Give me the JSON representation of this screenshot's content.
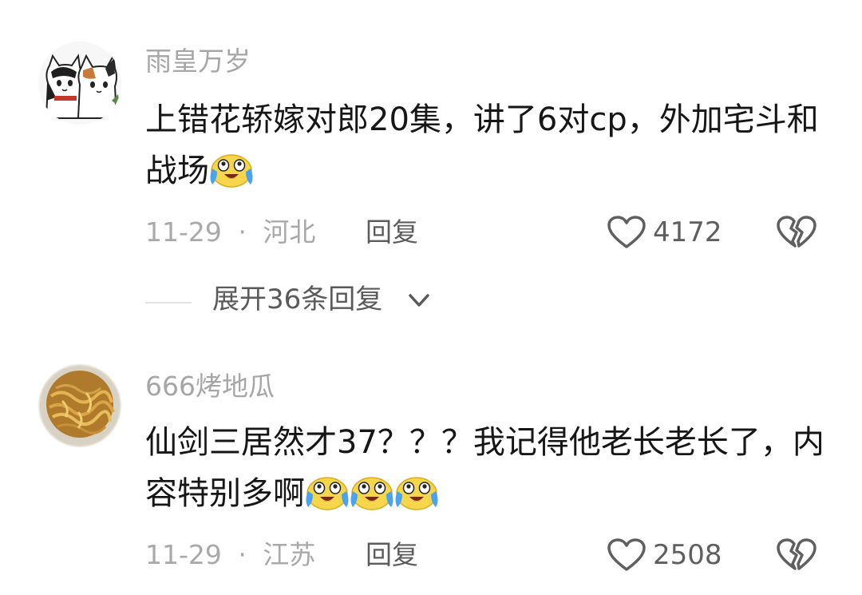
{
  "comments": [
    {
      "username": "雨皇万岁",
      "avatar": "cats-avatar",
      "content_text": "上错花轿嫁对郎20集，讲了6对cp，外加宅斗和战场",
      "emojis": [
        "crying-laughing-emoji"
      ],
      "date": "11-29",
      "separator": "·",
      "location": "河北",
      "reply_label": "回复",
      "likes": "4172"
    },
    {
      "username": "666烤地瓜",
      "avatar": "noodles-avatar",
      "content_text": "仙剑三居然才37？？？我记得他老长老长了，内容特别多啊",
      "emojis": [
        "crying-laughing-emoji",
        "crying-laughing-emoji",
        "crying-laughing-emoji"
      ],
      "date": "11-29",
      "separator": "·",
      "location": "江苏",
      "reply_label": "回复",
      "likes": "2508"
    }
  ],
  "expand_replies": {
    "label": "展开36条回复"
  },
  "colors": {
    "username": "#a6a6a6",
    "content": "#161616",
    "meta": "#a9a9a9",
    "icons": "#5f5f5f",
    "emoji_face": "#f6d64a"
  }
}
